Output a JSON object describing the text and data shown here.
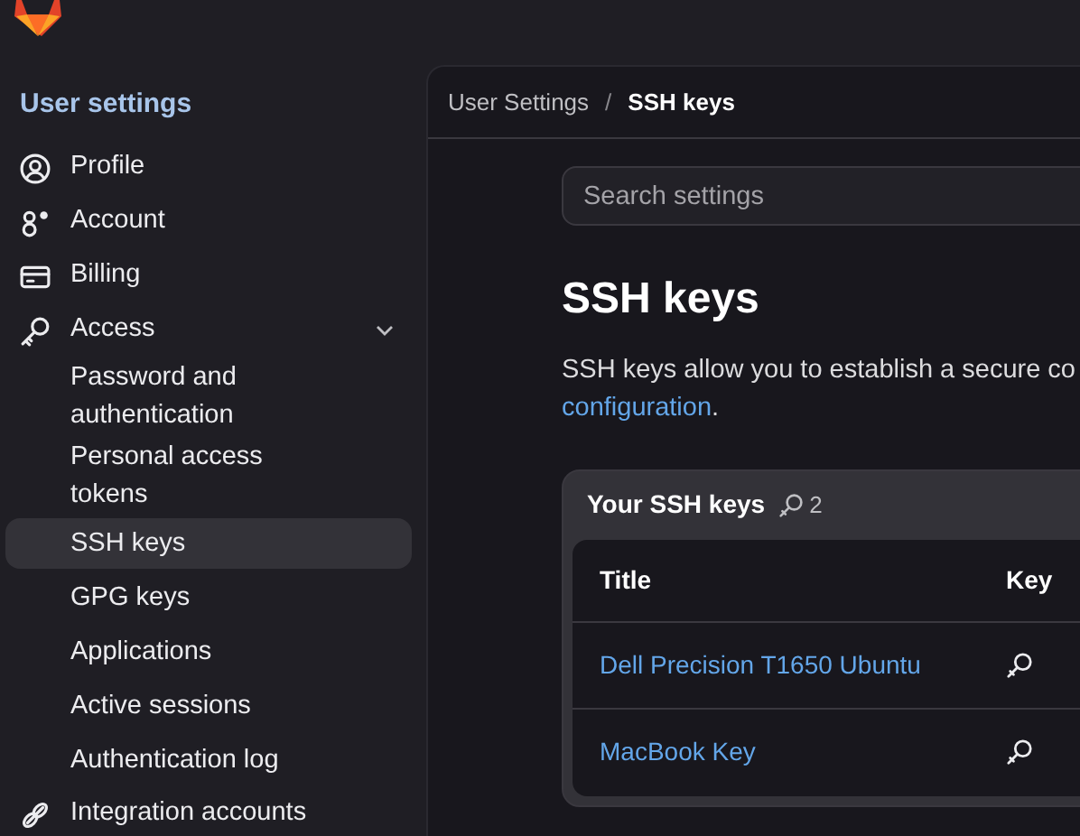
{
  "sidebar": {
    "title": "User settings",
    "items": [
      {
        "label": "Profile",
        "selected": false
      },
      {
        "label": "Account",
        "selected": false
      },
      {
        "label": "Billing",
        "selected": false
      },
      {
        "label": "Access",
        "selected": false,
        "expanded": true,
        "children": [
          {
            "label": "Password and authentication",
            "selected": false
          },
          {
            "label": "Personal access tokens",
            "selected": false
          },
          {
            "label": "SSH keys",
            "selected": true
          },
          {
            "label": "GPG keys",
            "selected": false
          },
          {
            "label": "Applications",
            "selected": false
          },
          {
            "label": "Active sessions",
            "selected": false
          },
          {
            "label": "Authentication log",
            "selected": false
          }
        ]
      },
      {
        "label": "Integration accounts",
        "selected": false
      }
    ]
  },
  "breadcrumb_separator": "/",
  "breadcrumb": [
    {
      "label": "User Settings",
      "current": false
    },
    {
      "label": "SSH keys",
      "current": true
    }
  ],
  "search": {
    "placeholder": "Search settings"
  },
  "heading": "SSH keys",
  "description": {
    "text": "SSH keys allow you to establish a secure co",
    "link": "configuration",
    "after": "."
  },
  "keys_card": {
    "title": "Your SSH keys",
    "count": "2",
    "table": {
      "columns": [
        "Title",
        "Key"
      ],
      "rows": [
        {
          "title": "Dell Precision T1650 Ubuntu"
        },
        {
          "title": "MacBook Key"
        }
      ]
    }
  }
}
